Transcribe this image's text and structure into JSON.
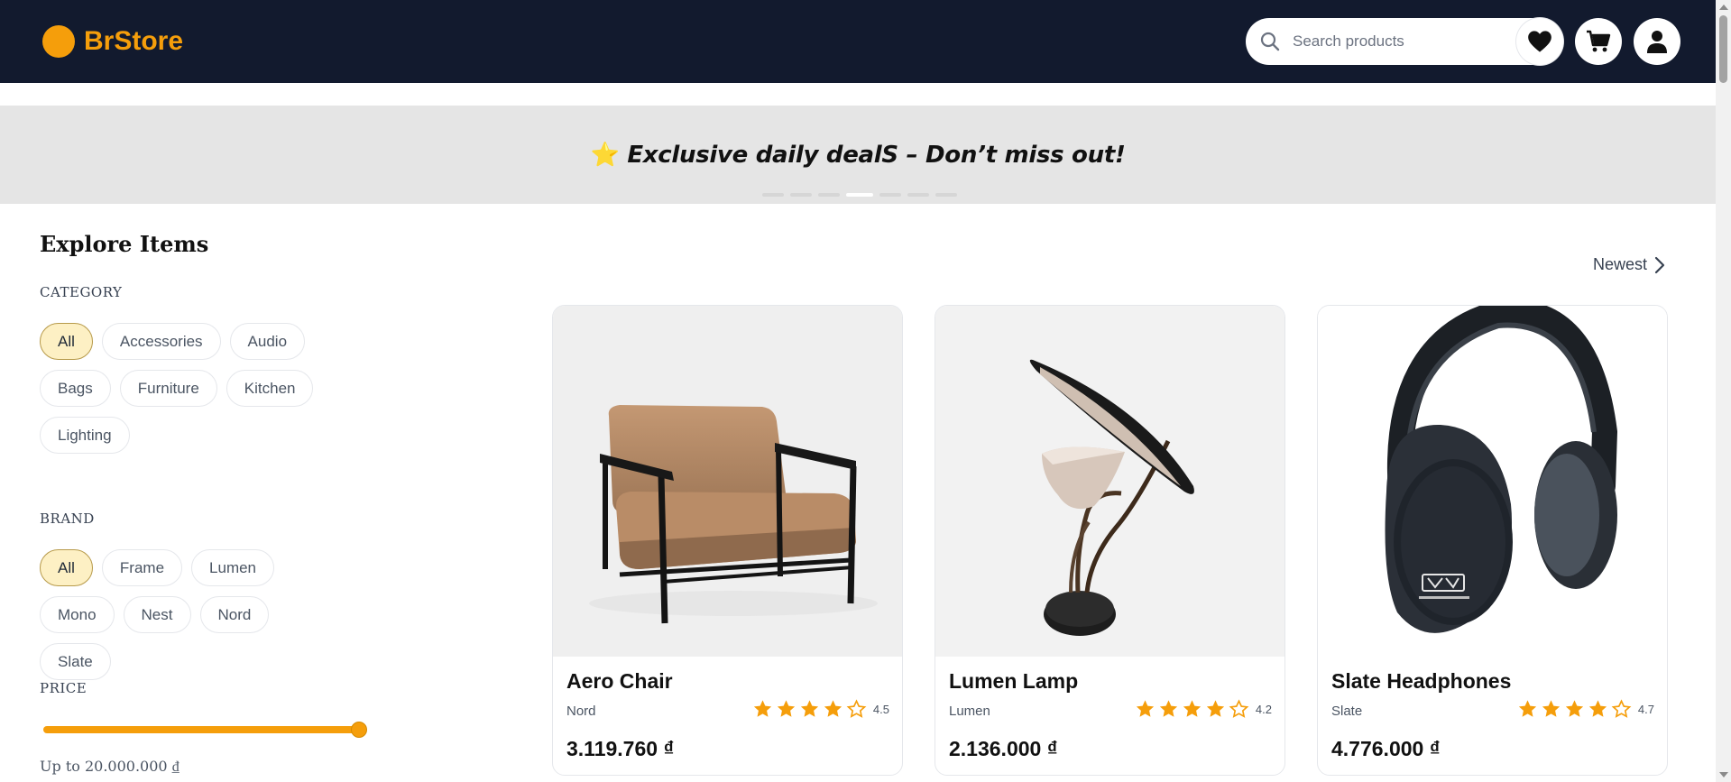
{
  "header": {
    "brand": "BrStore",
    "search_placeholder": "Search products",
    "icons": [
      "search-icon",
      "heart-icon",
      "cart-icon",
      "user-icon"
    ]
  },
  "banner": {
    "emoji": "⭐",
    "text": "Exclusive daily dealS – Don’t miss out!",
    "slide_count": 7,
    "active_slide": 4
  },
  "sidebar": {
    "title": "Explore Items",
    "category_label": "CATEGORY",
    "categories": [
      "All",
      "Accessories",
      "Audio",
      "Bags",
      "Furniture",
      "Kitchen",
      "Lighting"
    ],
    "category_selected": "All",
    "brand_label": "BRAND",
    "brands": [
      "All",
      "Frame",
      "Lumen",
      "Mono",
      "Nest",
      "Nord",
      "Slate"
    ],
    "brand_selected": "All",
    "price_label": "PRICE",
    "price_note": "Up to 20.000.000 ₫",
    "price_slider_fraction": 1.0
  },
  "sort": {
    "label": "Newest"
  },
  "products": [
    {
      "name": "Aero Chair",
      "brand": "Nord",
      "rating": "4.5",
      "stars": 4.5,
      "price": "3.119.760 ₫",
      "image": "armchair"
    },
    {
      "name": "Lumen Lamp",
      "brand": "Lumen",
      "rating": "4.2",
      "stars": 4.2,
      "price": "2.136.000 ₫",
      "image": "lamp"
    },
    {
      "name": "Slate Headphones",
      "brand": "Slate",
      "rating": "4.7",
      "stars": 4.7,
      "price": "4.776.000 ₫",
      "image": "headphones"
    }
  ],
  "colors": {
    "header_bg": "#121a2e",
    "accent": "#f59e0b",
    "chip_selected_bg": "#fdf0c4",
    "banner_bg": "#e5e5e5"
  }
}
